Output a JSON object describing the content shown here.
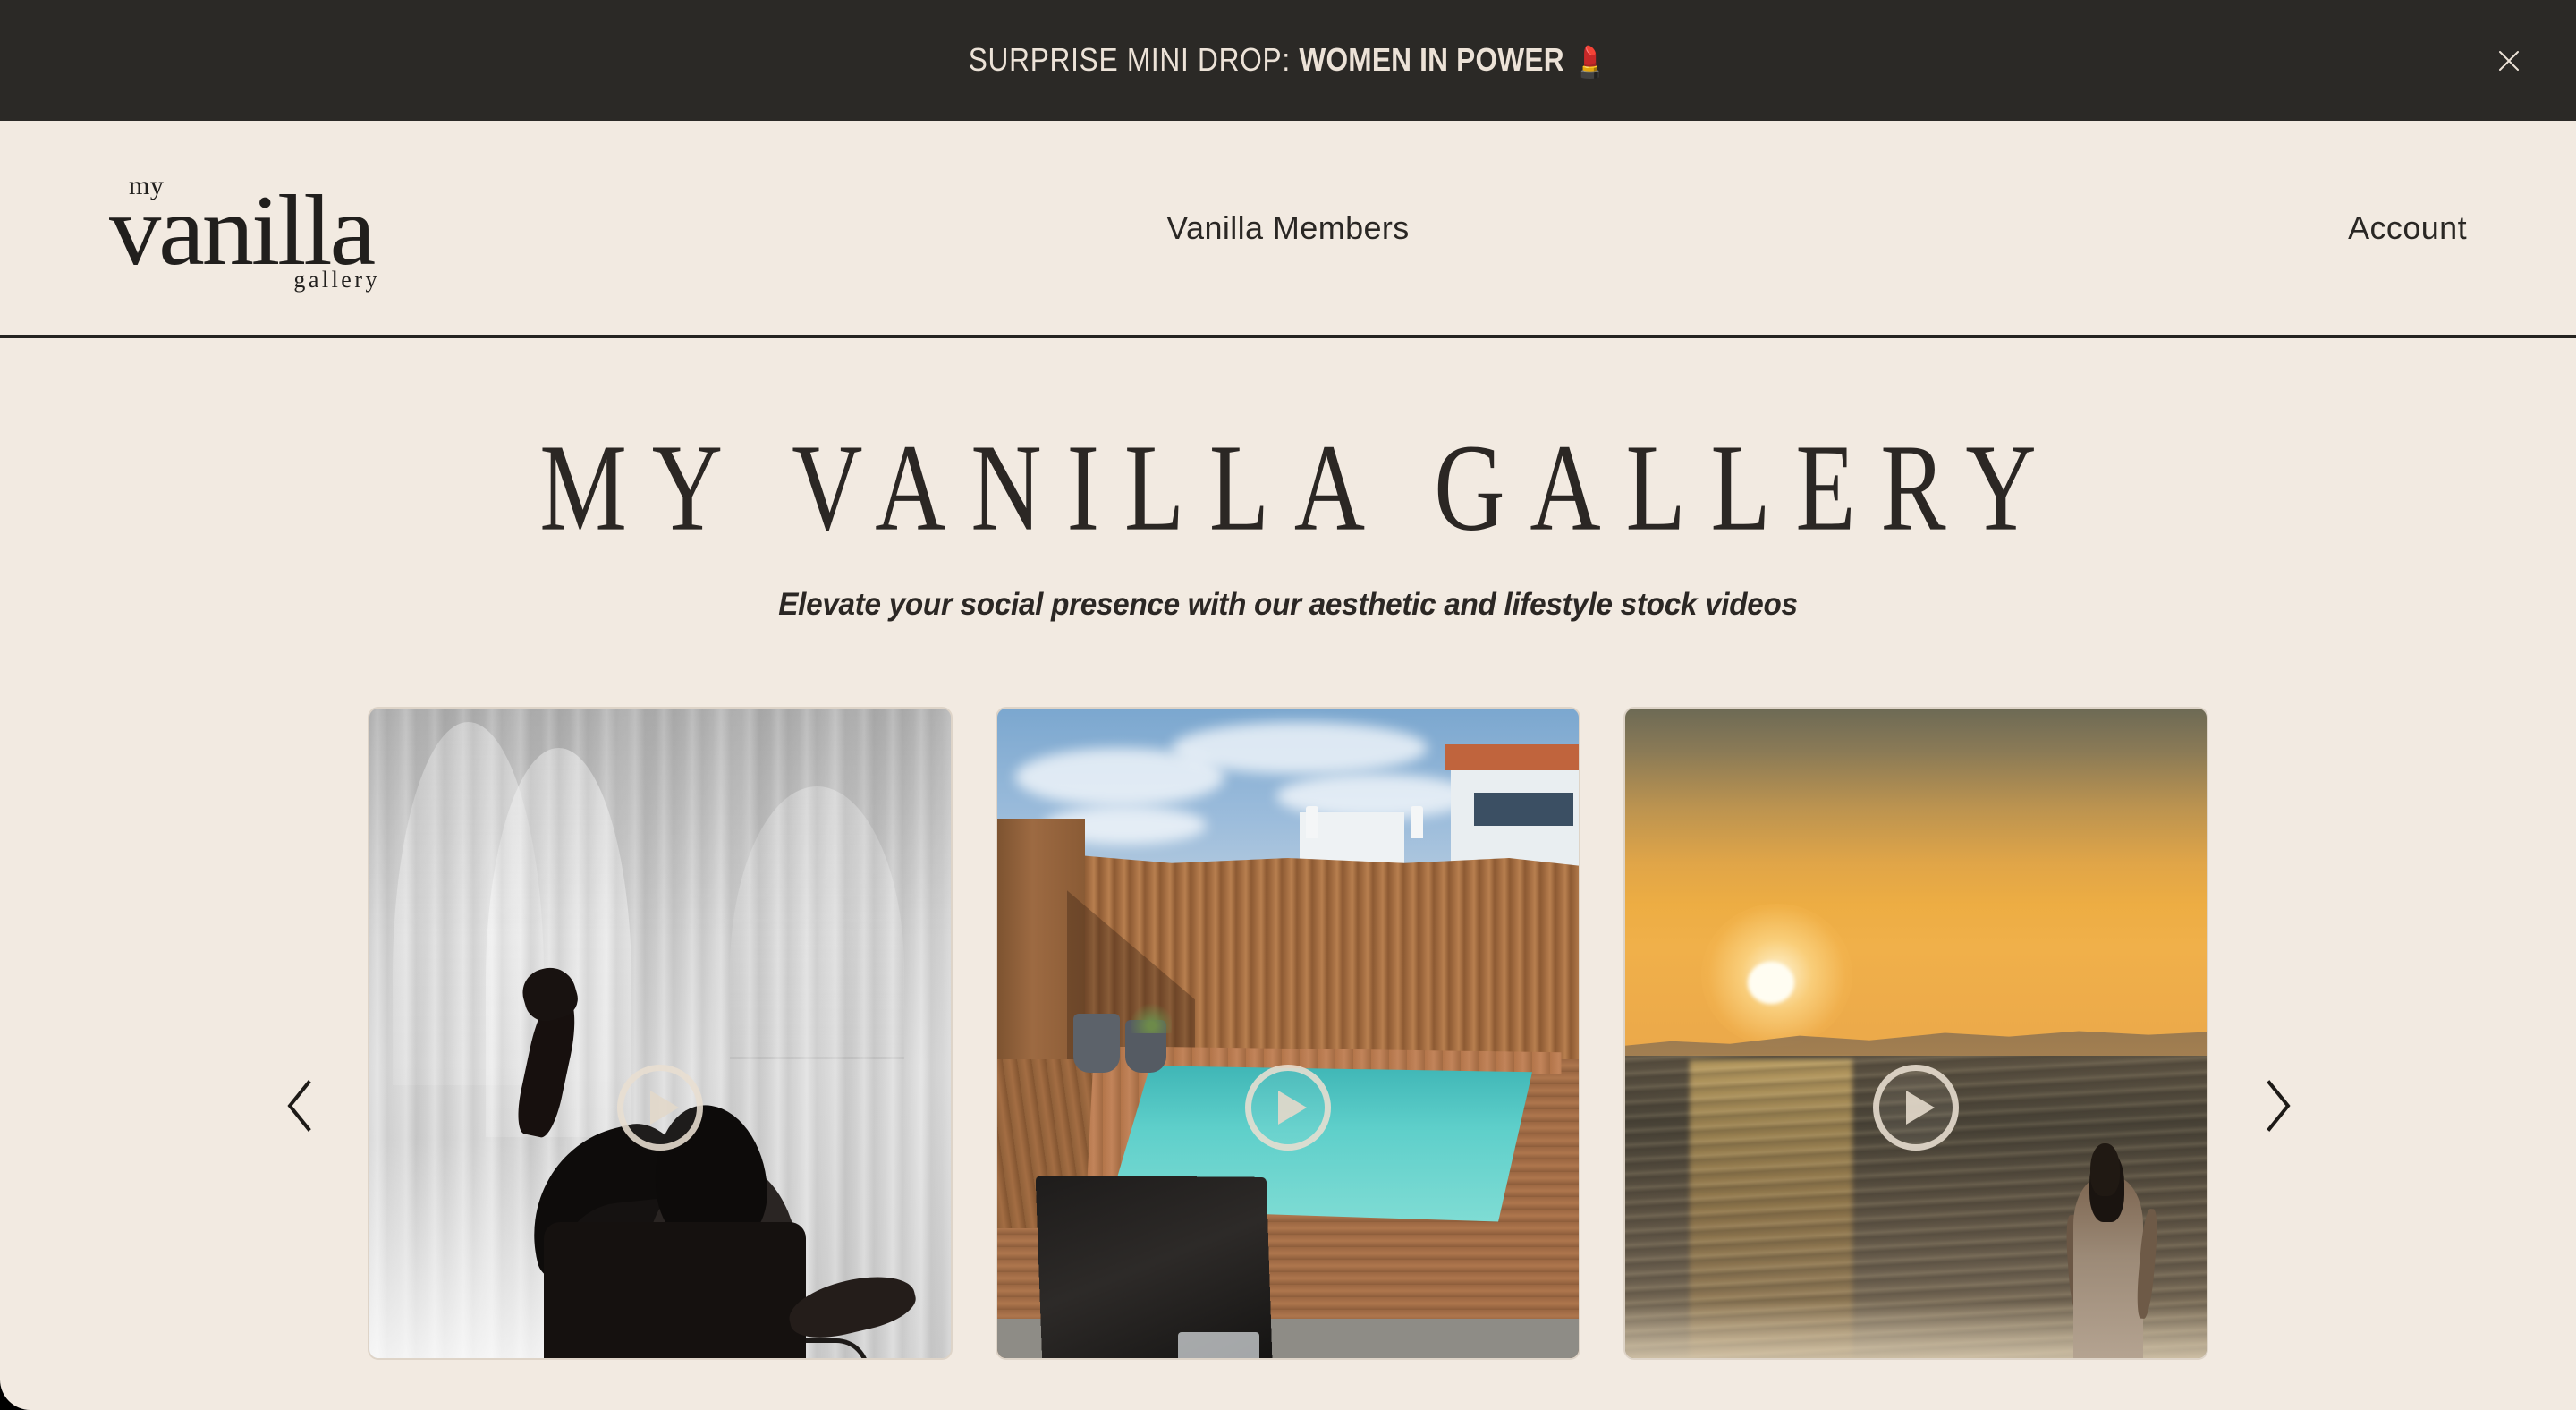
{
  "announcement": {
    "prefix": "SURPRISE MINI DROP: ",
    "highlight": "WOMEN IN POWER",
    "emoji": "💄",
    "close_label": "close-banner",
    "background": "#2b2926",
    "text_color": "#ece2d7"
  },
  "header": {
    "logo": {
      "line1": "my",
      "line2": "vanilla",
      "line3": "gallery"
    },
    "nav": {
      "members": "Vanilla Members",
      "account": "Account"
    },
    "background": "#f2eae1",
    "border_color": "#262421"
  },
  "hero": {
    "title": "MY VANILLA GALLERY",
    "subtitle": "Elevate your social presence with our aesthetic and lifestyle stock videos"
  },
  "carousel": {
    "prev_label": "Previous",
    "next_label": "Next",
    "play_label": "Play",
    "slides": [
      {
        "id": "slide-1",
        "alt": "Black and white video of a woman seated on a chair flipping her long hair, sheer curtains and arched windows behind her"
      },
      {
        "id": "slide-2",
        "alt": "Video of a small turquoise swimming pool on a wooden deck behind a slatted wood fence, a laptop on a table in the foreground"
      },
      {
        "id": "slide-3",
        "alt": "Video of a golden sunset over the ocean with a woman in a long dress walking into the waves"
      }
    ]
  },
  "theme": {
    "page_background": "#f2eae1",
    "ink": "#2b2724",
    "play_ring": "#e8ded0"
  }
}
